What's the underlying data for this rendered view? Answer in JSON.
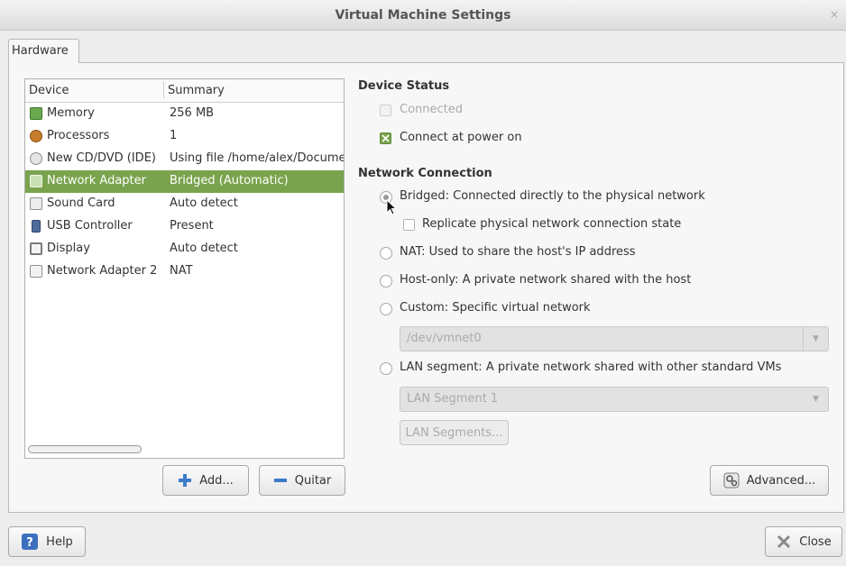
{
  "window": {
    "title": "Virtual Machine Settings",
    "close_glyph": "×"
  },
  "tabs": [
    {
      "label": "Hardware"
    }
  ],
  "device_list": {
    "headers": {
      "device": "Device",
      "summary": "Summary"
    },
    "rows": [
      {
        "name": "Memory",
        "summary": "256 MB",
        "icon": "memory-icon"
      },
      {
        "name": "Processors",
        "summary": "1",
        "icon": "processor-icon"
      },
      {
        "name": "New CD/DVD (IDE)",
        "summary": "Using file /home/alex/Docume",
        "icon": "cd-dvd-icon"
      },
      {
        "name": "Network Adapter",
        "summary": "Bridged (Automatic)",
        "icon": "network-adapter-icon",
        "selected": true
      },
      {
        "name": "Sound Card",
        "summary": "Auto detect",
        "icon": "sound-card-icon"
      },
      {
        "name": "USB Controller",
        "summary": "Present",
        "icon": "usb-icon"
      },
      {
        "name": "Display",
        "summary": "Auto detect",
        "icon": "display-icon"
      },
      {
        "name": "Network Adapter 2",
        "summary": "NAT",
        "icon": "network-adapter-icon"
      }
    ],
    "add_label": "Add...",
    "remove_label": "Quitar"
  },
  "device_status": {
    "title": "Device Status",
    "connected": {
      "label": "Connected",
      "checked": false,
      "enabled": false
    },
    "connect_at_power_on": {
      "label": "Connect at power on",
      "checked": true
    }
  },
  "network_connection": {
    "title": "Network Connection",
    "bridged": {
      "label": "Bridged: Connected directly to the physical network",
      "selected": true
    },
    "replicate": {
      "label": "Replicate physical network connection state",
      "checked": false
    },
    "nat": {
      "label": "NAT: Used to share the host's IP address"
    },
    "host_only": {
      "label": "Host-only: A private network shared with the host"
    },
    "custom": {
      "label": "Custom: Specific virtual network",
      "value": "/dev/vmnet0"
    },
    "lan_segment": {
      "label": "LAN segment: A private network shared with other standard VMs",
      "value": "LAN Segment 1",
      "button_label": "LAN Segments..."
    },
    "advanced_label": "Advanced..."
  },
  "footer": {
    "help_label": "Help",
    "close_label": "Close"
  },
  "colors": {
    "selection": "#7aa34d",
    "accent_blue": "#3d7cc9"
  }
}
